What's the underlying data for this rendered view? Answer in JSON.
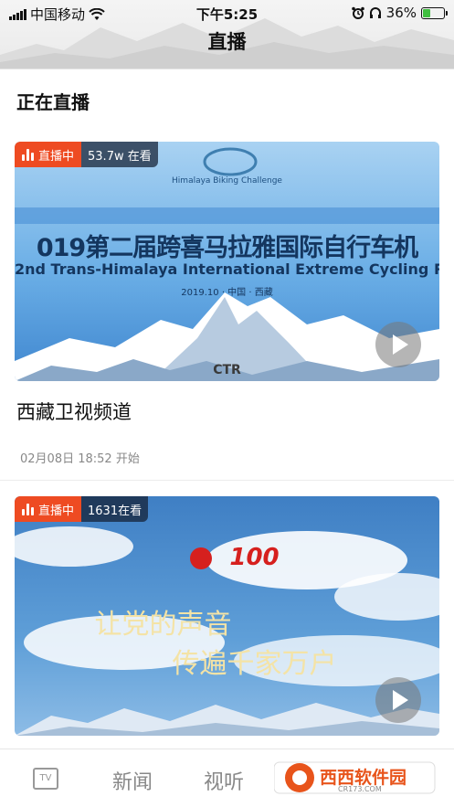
{
  "status_bar": {
    "carrier": "中国移动",
    "time": "下午5:25",
    "battery_percent": "36%",
    "battery_level": 0.36,
    "battery_color": "#3fbf3f"
  },
  "header": {
    "title": "直播"
  },
  "section": {
    "title": "正在直播"
  },
  "cards": [
    {
      "badge_live": "直播中",
      "viewers": "53.7w 在看",
      "banner": {
        "logo_caption": "Himalaya Biking Challenge",
        "headline_cn": "019第二届跨喜马拉雅国际自行车机",
        "headline_en": "2nd Trans-Himalaya International Extreme Cycling R",
        "date_place": "2019.10 · 中国 · 西藏",
        "watermark": "CTR"
      },
      "title": "西藏卫视频道",
      "time": "02月08日 18:52 开始"
    },
    {
      "badge_live": "直播中",
      "viewers": "1631在看",
      "banner": {
        "number": "100",
        "line1": "让党的声音",
        "line2": "传遍千家万户"
      }
    }
  ],
  "tabbar": {
    "tv_icon_text": "TV",
    "tabs": [
      "新闻",
      "视听"
    ],
    "watermark": "西西软件园",
    "watermark_url": "CR173.COM"
  },
  "colors": {
    "live_red": "#ee4b22",
    "sky_blue": "#5f9fd8",
    "text_dark": "#111111",
    "text_grey": "#888888"
  }
}
